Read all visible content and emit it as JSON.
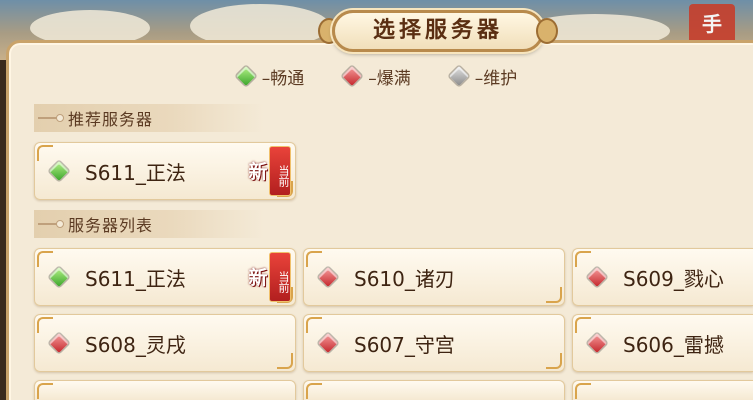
{
  "dialog": {
    "title": "选择服务器"
  },
  "legend": [
    {
      "icon": "green-gem-icon",
      "color": "green",
      "label": "–畅通"
    },
    {
      "icon": "red-gem-icon",
      "color": "red",
      "label": "–爆满"
    },
    {
      "icon": "gray-gem-icon",
      "color": "gray",
      "label": "–维护"
    }
  ],
  "recommended": {
    "heading": "推荐服务器",
    "servers": [
      {
        "name": "S611_正法",
        "status": "green",
        "badge_new": "新",
        "badge_current": "当前"
      }
    ]
  },
  "server_list": {
    "heading": "服务器列表",
    "servers": [
      {
        "name": "S611_正法",
        "status": "green",
        "badge_new": "新",
        "badge_current": "当前"
      },
      {
        "name": "S610_诸刃",
        "status": "red"
      },
      {
        "name": "S609_戮心",
        "status": "red"
      },
      {
        "name": "S608_灵戌",
        "status": "red"
      },
      {
        "name": "S607_守宫",
        "status": "red"
      },
      {
        "name": "S606_雷撼",
        "status": "red"
      }
    ]
  },
  "background": {
    "corner_badge": "手"
  },
  "colors": {
    "panel_bg": "#f4ead7",
    "border": "#c9a36a",
    "title_text": "#5a2e12",
    "new_badge": "#c4262b",
    "current_badge": "#b21f1f"
  }
}
